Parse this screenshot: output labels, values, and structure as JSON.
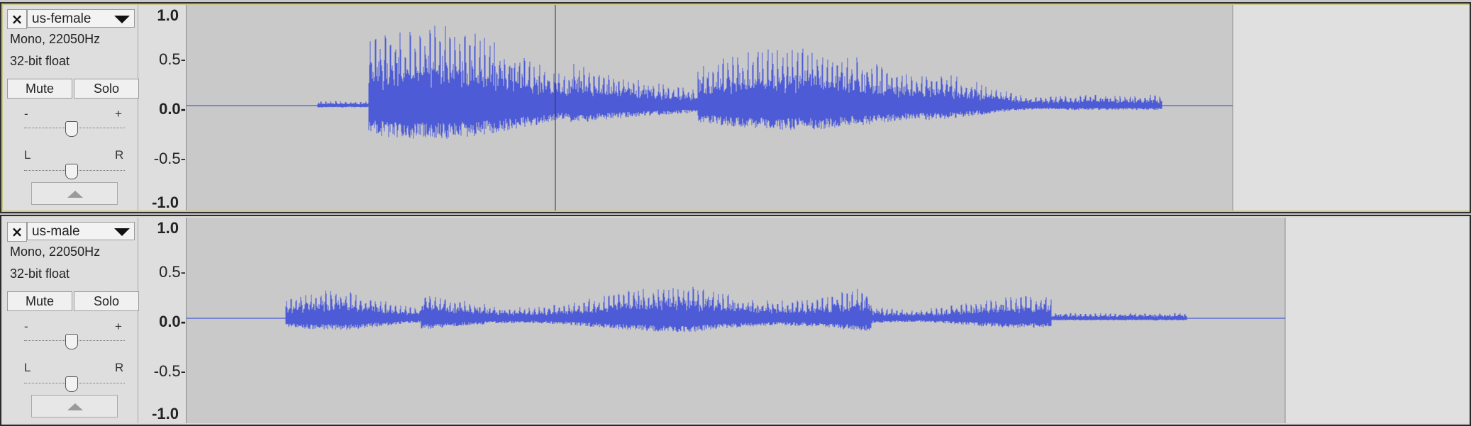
{
  "tracks": [
    {
      "name": "us-female",
      "format": "Mono, 22050Hz",
      "sample_format": "32-bit float",
      "mute_label": "Mute",
      "solo_label": "Solo",
      "gain_minus": "-",
      "gain_plus": "+",
      "pan_left": "L",
      "pan_right": "R",
      "scale": {
        "top": "1.0",
        "upper": "0.5-",
        "zero": "0.0-",
        "lower": "-0.5-",
        "bottom": "-1.0"
      },
      "selected": true
    },
    {
      "name": "us-male",
      "format": "Mono, 22050Hz",
      "sample_format": "32-bit float",
      "mute_label": "Mute",
      "solo_label": "Solo",
      "gain_minus": "-",
      "gain_plus": "+",
      "pan_left": "L",
      "pan_right": "R",
      "scale": {
        "top": "1.0",
        "upper": "0.5-",
        "zero": "0.0-",
        "lower": "-0.5-",
        "bottom": "-1.0"
      },
      "selected": false
    }
  ],
  "colors": {
    "waveform": "#4d5bd6",
    "clip_background": "#c9c9c9",
    "empty_background": "#e0e0e0",
    "selection_border": "#d8d49a"
  },
  "icons": {
    "close": "close-icon",
    "menu": "dropdown-arrow-icon",
    "collapse": "collapse-up-icon"
  }
}
